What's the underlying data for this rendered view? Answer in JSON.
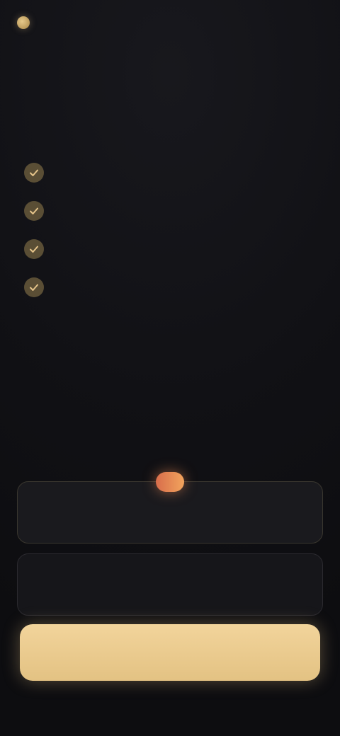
{
  "header": {
    "brand": "",
    "restore_label": ""
  },
  "headline": {
    "line1_main": "",
    "line1_accent": "",
    "line2": ""
  },
  "features": [
    {
      "text": ""
    },
    {
      "text": ""
    },
    {
      "text": ""
    },
    {
      "text": ""
    }
  ],
  "about": {
    "title": "",
    "body": ""
  },
  "plans": [
    {
      "name": "",
      "price": "",
      "badge": "",
      "selected": true
    },
    {
      "name": "",
      "price": "",
      "badge": "",
      "selected": false
    }
  ],
  "cta": {
    "label": ""
  },
  "colors": {
    "accent_gold": "#e5c48a",
    "badge_gradient_start": "#d86d4b",
    "badge_gradient_end": "#f2a45d",
    "background": "#111115"
  },
  "icons": {
    "feature": "check-icon",
    "brand": "logo-icon"
  }
}
